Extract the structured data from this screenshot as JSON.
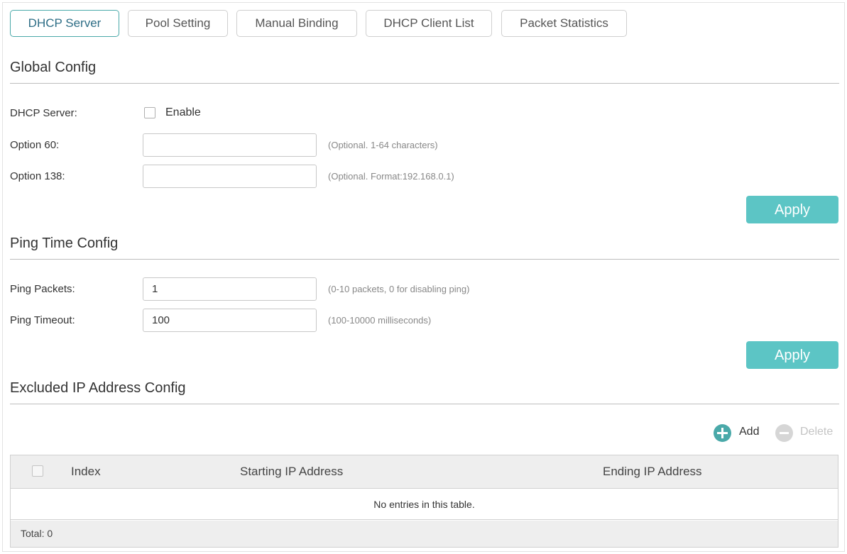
{
  "tabs": [
    {
      "label": "DHCP Server",
      "active": true
    },
    {
      "label": "Pool Setting",
      "active": false
    },
    {
      "label": "Manual Binding",
      "active": false
    },
    {
      "label": "DHCP Client List",
      "active": false
    },
    {
      "label": "Packet Statistics",
      "active": false
    }
  ],
  "global_config": {
    "title": "Global Config",
    "dhcp_server_label": "DHCP Server:",
    "enable_label": "Enable",
    "enable_checked": false,
    "option60_label": "Option 60:",
    "option60_value": "",
    "option60_hint": "(Optional. 1-64 characters)",
    "option138_label": "Option 138:",
    "option138_value": "",
    "option138_hint": "(Optional. Format:192.168.0.1)",
    "apply_label": "Apply"
  },
  "ping_config": {
    "title": "Ping Time Config",
    "packets_label": "Ping Packets:",
    "packets_value": "1",
    "packets_hint": "(0-10 packets, 0 for disabling ping)",
    "timeout_label": "Ping Timeout:",
    "timeout_value": "100",
    "timeout_hint": "(100-10000 milliseconds)",
    "apply_label": "Apply"
  },
  "excluded_config": {
    "title": "Excluded IP Address Config",
    "add_label": "Add",
    "delete_label": "Delete",
    "columns": [
      "Index",
      "Starting IP Address",
      "Ending IP Address"
    ],
    "empty_message": "No entries in this table.",
    "total_label": "Total: 0"
  },
  "colors": {
    "accent": "#5cc5c5",
    "active_tab_border": "#4aa9a9",
    "active_tab_text": "#2e6e86",
    "delete_disabled": "#d6d6d6"
  },
  "icons": [
    "add-icon",
    "delete-icon"
  ]
}
